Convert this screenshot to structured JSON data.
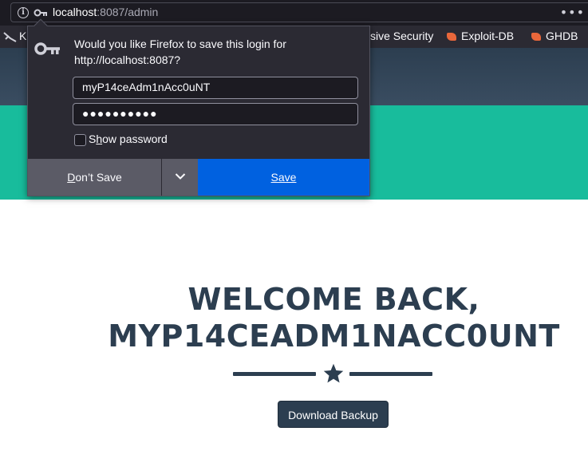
{
  "browser": {
    "url_host": "localhost",
    "url_rest": ":8087/admin",
    "menu_icon": "more-dots-icon"
  },
  "bookmarks": [
    {
      "label": "K"
    },
    {
      "label": "sive Security"
    },
    {
      "label": "Exploit-DB"
    },
    {
      "label": "GHDB"
    }
  ],
  "save_login": {
    "message": "Would you like Firefox to save this login for http://localhost:8087?",
    "username_value": "myP14ceAdm1nAcc0uNT",
    "password_value": "●●●●●●●●●●",
    "show_password_label_first": "S",
    "show_password_label_underlined": "h",
    "show_password_label_rest": "ow password",
    "dont_save_prefix": "D",
    "dont_save_underlined": "o",
    "dont_save_rest": "n’t Save",
    "save_label": "Save"
  },
  "page": {
    "welcome_line1": "WELCOME BACK,",
    "welcome_line2": "MYP14CEADM1NACC0UNT",
    "download_label": "Download Backup"
  },
  "colors": {
    "navy": "#2c3e50",
    "teal": "#18bc9c",
    "firefox_blue": "#0061e0",
    "bookmark_orange": "#e9673b"
  }
}
